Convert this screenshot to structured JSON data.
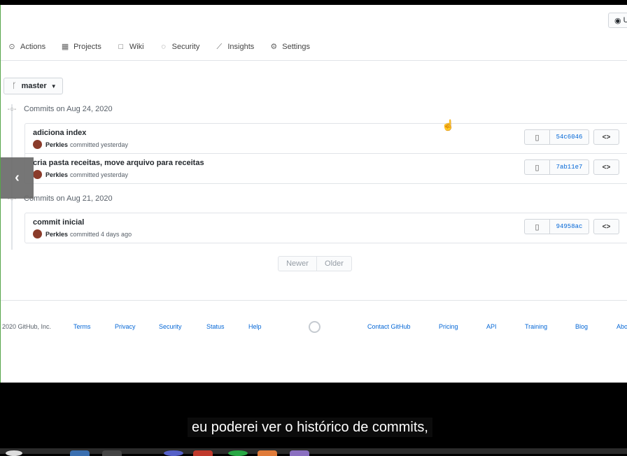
{
  "header": {
    "watch_label": "U"
  },
  "nav": {
    "tabs": [
      {
        "label": "Actions",
        "icon": "play-circle-icon"
      },
      {
        "label": "Projects",
        "icon": "project-board-icon"
      },
      {
        "label": "Wiki",
        "icon": "book-icon"
      },
      {
        "label": "Security",
        "icon": "shield-icon"
      },
      {
        "label": "Insights",
        "icon": "graph-icon"
      },
      {
        "label": "Settings",
        "icon": "gear-icon"
      }
    ]
  },
  "branch": {
    "name": "master"
  },
  "groups": [
    {
      "date_label": "Commits on Aug 24, 2020",
      "commits": [
        {
          "message": "adiciona index",
          "author": "Perkles",
          "when": "committed yesterday",
          "sha": "54c6046"
        },
        {
          "message": "cria pasta receitas, move arquivo para receitas",
          "author": "Perkles",
          "when": "committed yesterday",
          "sha": "7ab11e7"
        }
      ]
    },
    {
      "date_label": "Commits on Aug 21, 2020",
      "commits": [
        {
          "message": "commit inicial",
          "author": "Perkles",
          "when": "committed 4 days ago",
          "sha": "94958ac"
        }
      ]
    }
  ],
  "pagination": {
    "newer": "Newer",
    "older": "Older"
  },
  "footer": {
    "copyright": "2020 GitHub, Inc.",
    "left_links": [
      "Terms",
      "Privacy",
      "Security",
      "Status",
      "Help"
    ],
    "right_links": [
      "Contact GitHub",
      "Pricing",
      "API",
      "Training",
      "Blog",
      "Abo"
    ]
  },
  "subtitle": "eu poderei ver o histórico de commits,",
  "colors": {
    "link": "#0366d6",
    "border": "#e1e4e8"
  }
}
